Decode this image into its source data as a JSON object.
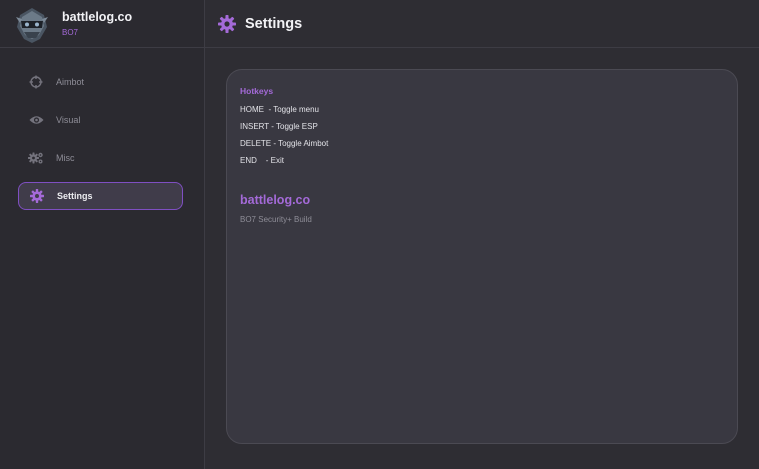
{
  "brand": {
    "name": "battlelog.co",
    "subtitle": "BO7"
  },
  "sidebar": {
    "items": [
      {
        "label": "Aimbot",
        "icon": "crosshair-icon",
        "active": false
      },
      {
        "label": "Visual",
        "icon": "eye-icon",
        "active": false
      },
      {
        "label": "Misc",
        "icon": "gears-icon",
        "active": false
      },
      {
        "label": "Settings",
        "icon": "gear-icon",
        "active": true
      }
    ]
  },
  "header": {
    "title": "Settings",
    "icon": "gear-icon"
  },
  "panel": {
    "hotkeys_title": "Hotkeys",
    "hotkeys": [
      "HOME  - Toggle menu",
      "INSERT - Toggle ESP",
      "DELETE - Toggle Aimbot",
      "END    - Exit"
    ],
    "brand_name": "battlelog.co",
    "build": "BO7 Security+ Build"
  },
  "colors": {
    "accent": "#a46ad8",
    "active_border": "#7f4fc2",
    "background": "#2e2d33",
    "panel": "#393841"
  }
}
